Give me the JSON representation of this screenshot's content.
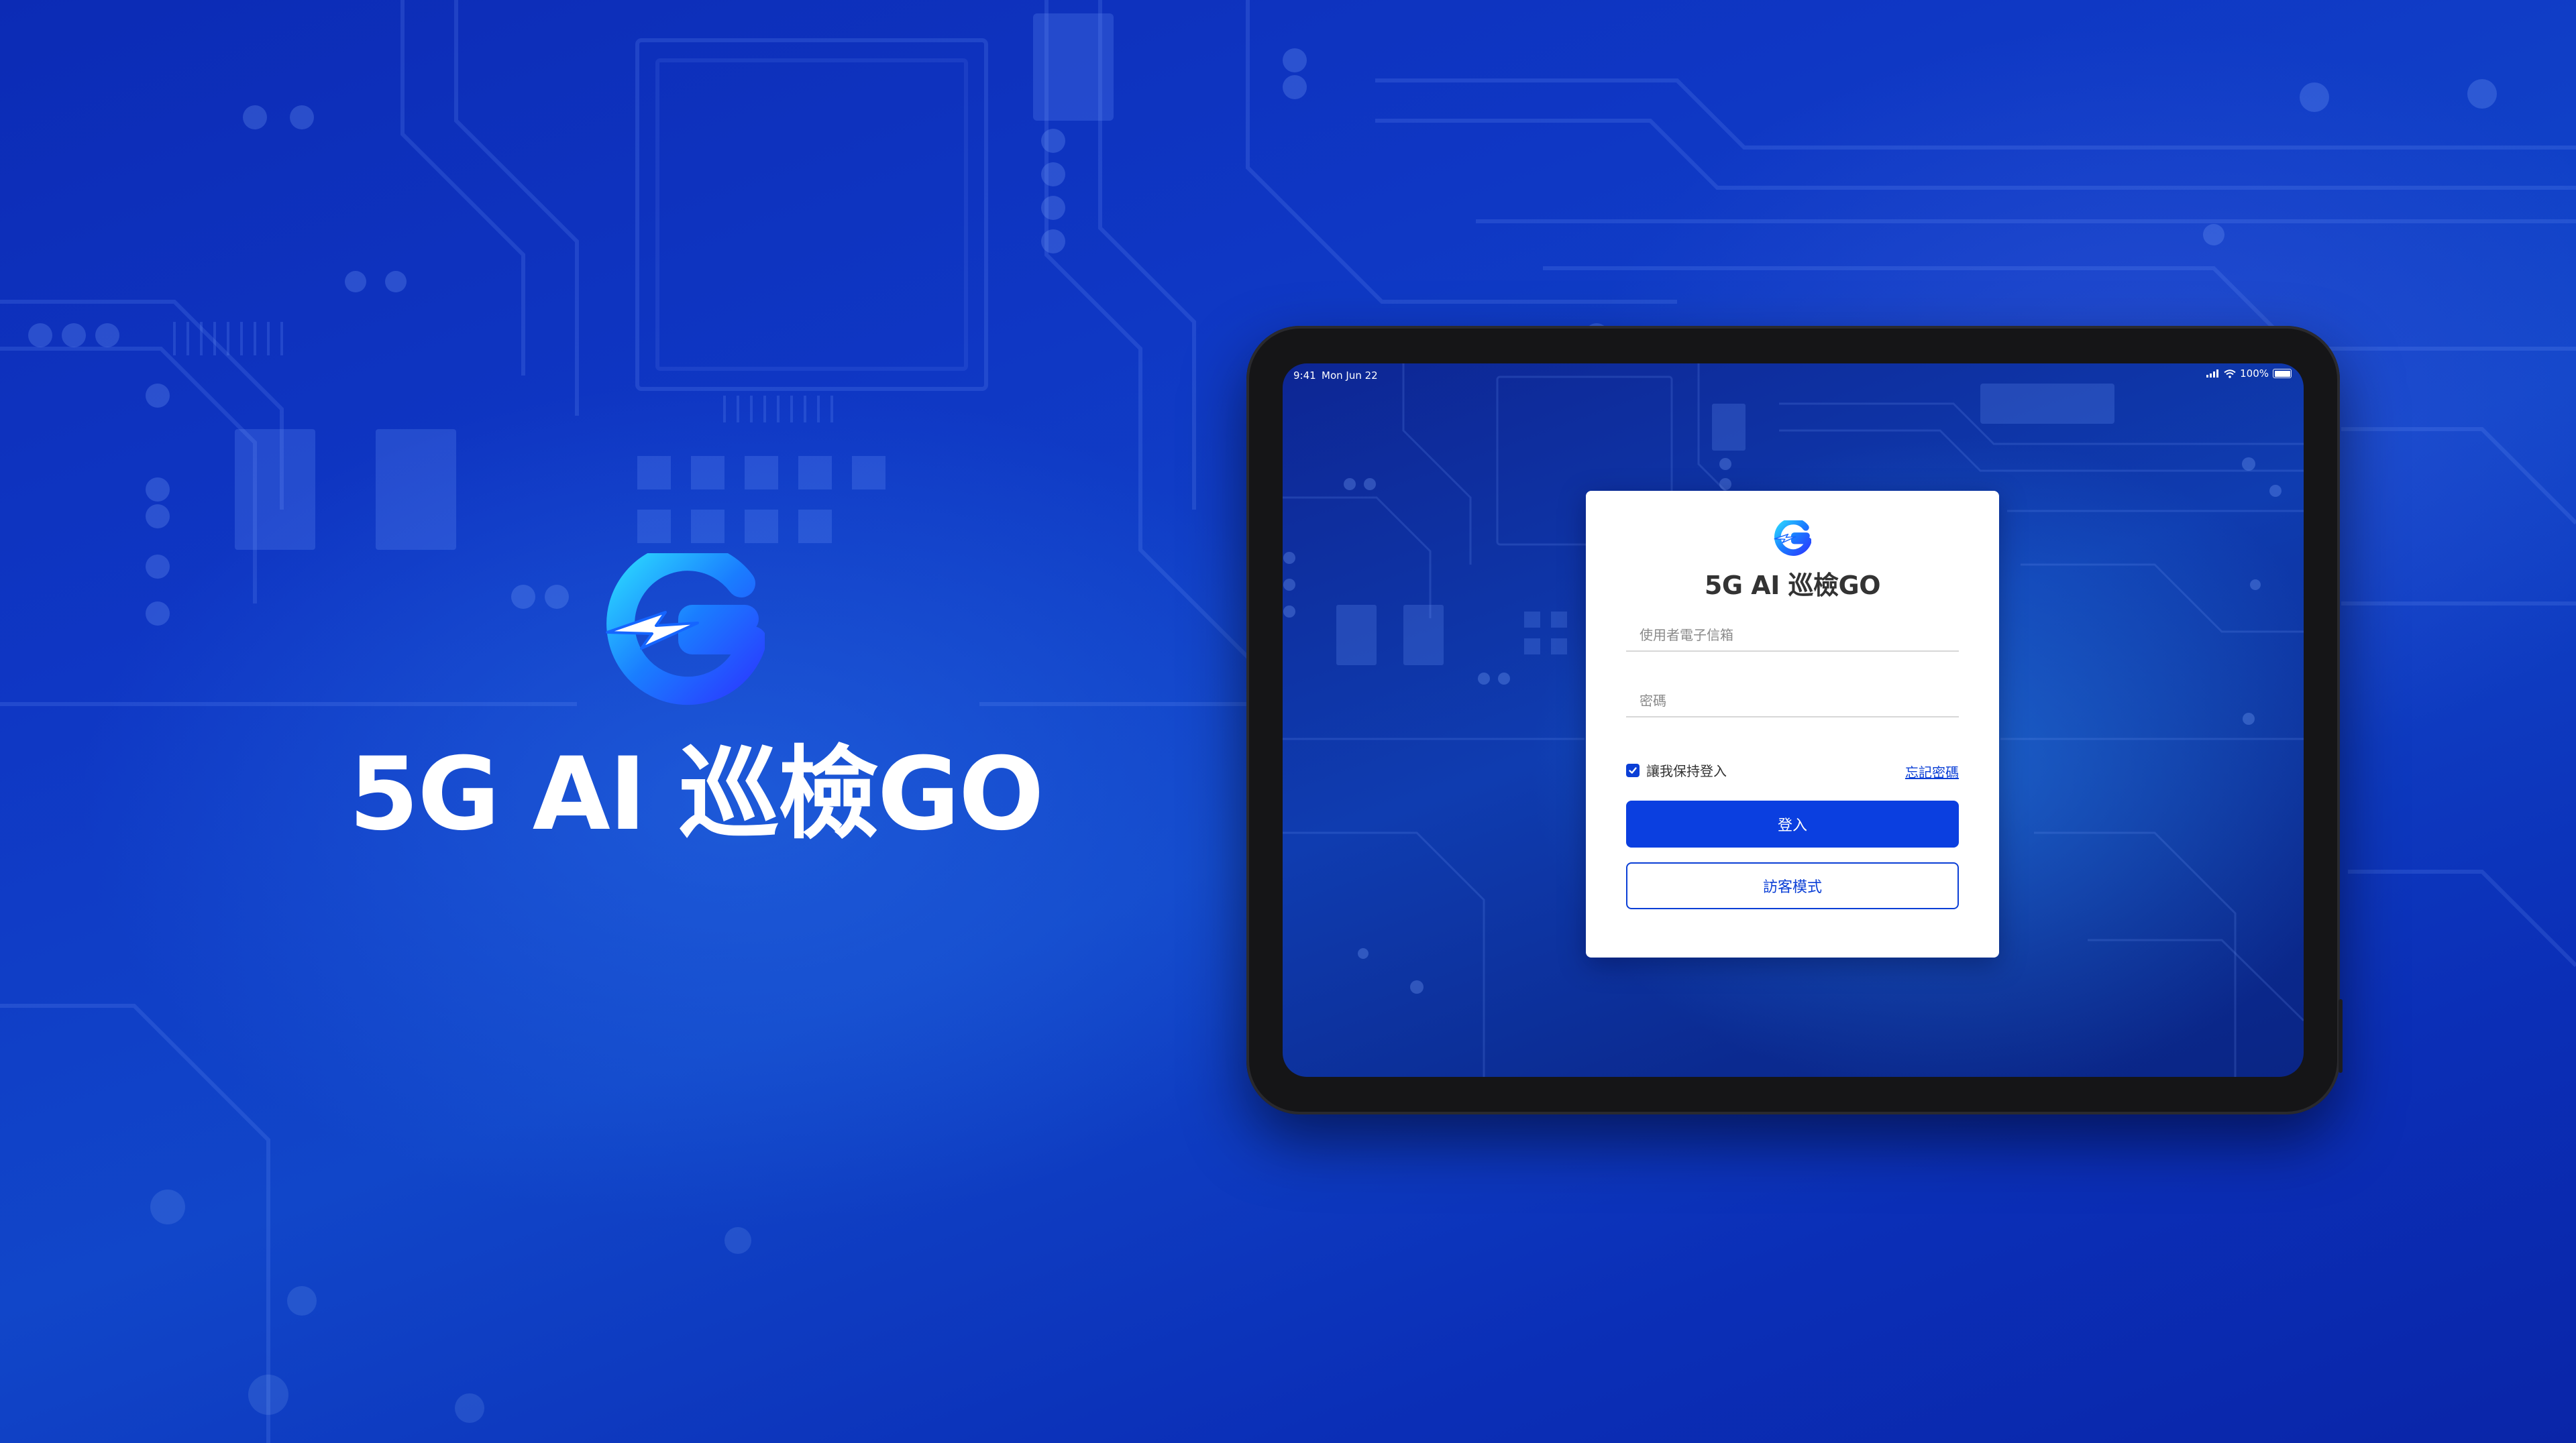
{
  "brand": {
    "title": "5G AI 巡檢GO",
    "logo_icon": "g-lightning-logo-icon"
  },
  "status_bar": {
    "time": "9:41",
    "date": "Mon Jun 22",
    "battery": "100%",
    "icons": [
      "signal-icon",
      "wifi-icon",
      "battery-icon"
    ]
  },
  "login": {
    "title": "5G AI 巡檢GO",
    "email_placeholder": "使用者電子信箱",
    "password_placeholder": "密碼",
    "remember_label": "讓我保持登入",
    "remember_checked": true,
    "forgot_label": "忘記密碼",
    "login_button": "登入",
    "guest_button": "訪客模式"
  },
  "colors": {
    "accent": "#0b3fe0",
    "background": "#0f37c4",
    "card": "#ffffff"
  }
}
